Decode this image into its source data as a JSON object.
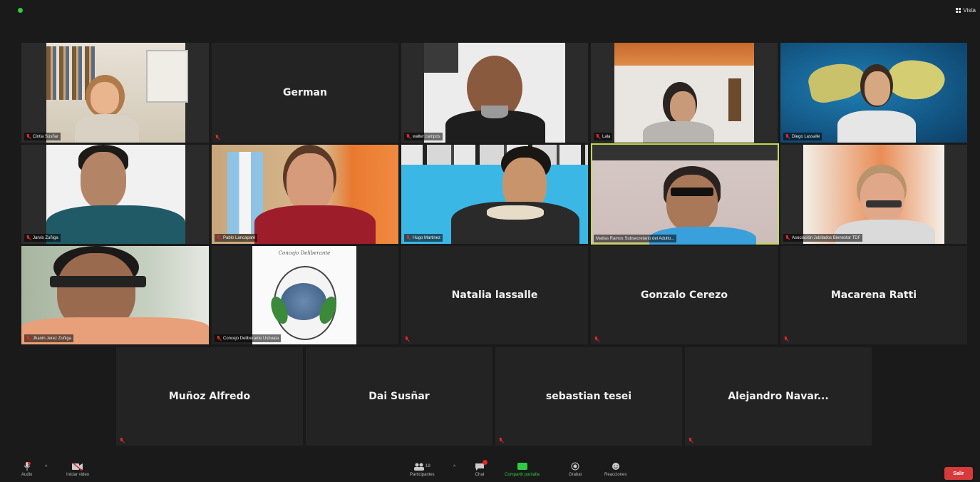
{
  "topbar": {
    "view_label": "Vista"
  },
  "participants": [
    {
      "id": "cintia",
      "label": "Cintia Susñar",
      "type": "video",
      "muted": true
    },
    {
      "id": "german",
      "name": "German",
      "label": "",
      "type": "name",
      "muted": true
    },
    {
      "id": "walter",
      "label": "walter campos",
      "type": "video",
      "muted": true
    },
    {
      "id": "lala",
      "label": "Lala",
      "type": "video",
      "muted": true
    },
    {
      "id": "diego",
      "label": "Diego Lassalle",
      "type": "video",
      "muted": true
    },
    {
      "id": "jarvis",
      "label": "Jarvis Zuñiga",
      "type": "video",
      "muted": true
    },
    {
      "id": "pablo",
      "label": "Pablo Lancaparé",
      "type": "video",
      "muted": true
    },
    {
      "id": "hugo",
      "label": "Hugo Martinez",
      "type": "video",
      "muted": true
    },
    {
      "id": "matias",
      "label": "Matías Ramos Subsecretario del Adulto...",
      "type": "video",
      "muted": false,
      "speaking": true
    },
    {
      "id": "asociacion",
      "label": "Asociación Jubilados Bienestar TDF",
      "type": "video",
      "muted": true
    },
    {
      "id": "jhan",
      "label": "Jhanin Jerez Zuñiga",
      "type": "video",
      "muted": true
    },
    {
      "id": "concejo",
      "label": "Concejo Deliberante Ushuaia",
      "type": "logo",
      "muted": true,
      "logo_text": "Concejo Deliberante"
    },
    {
      "id": "natalia",
      "name": "Natalia lassalle",
      "type": "name",
      "muted": true
    },
    {
      "id": "gonzalo",
      "name": "Gonzalo Cerezo",
      "type": "name",
      "muted": true
    },
    {
      "id": "macarena",
      "name": "Macarena Ratti",
      "type": "name",
      "muted": true
    },
    {
      "id": "munoz",
      "name": "Muñoz Alfredo",
      "type": "name",
      "muted": true
    },
    {
      "id": "dai",
      "name": "Dai Susñar",
      "type": "name",
      "muted": false
    },
    {
      "id": "sebastian",
      "name": "sebastian tesei",
      "type": "name",
      "muted": true
    },
    {
      "id": "alejandro",
      "name": "Alejandro  Navar...",
      "type": "name",
      "muted": true
    }
  ],
  "toolbar": {
    "audio": "Audio",
    "video": "Iniciar video",
    "participants": "Participantes",
    "participants_count": "19",
    "chat": "Chat",
    "share": "Compartir pantalla",
    "record": "Grabar",
    "reactions": "Reacciones",
    "leave": "Salir"
  },
  "colors": {
    "speaking_border": "#c5d94a",
    "mute_red": "#e02828",
    "share_green": "#2ecc40",
    "leave_red": "#d63a3a"
  }
}
